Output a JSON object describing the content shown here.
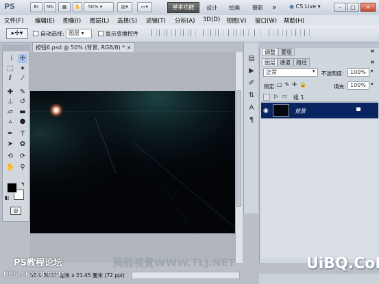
{
  "titlebar": {
    "app_logo": "PS",
    "small_btns": [
      "Br",
      "Mb"
    ],
    "zoom": "50%",
    "workspace_active": "基本功能",
    "workspaces": [
      "设计",
      "绘画",
      "摄影"
    ],
    "more": "»",
    "cslive": "CS Live",
    "window_controls": [
      "–",
      "□",
      "×"
    ]
  },
  "menu": [
    "文件(F)",
    "编辑(E)",
    "图像(I)",
    "图层(L)",
    "选择(S)",
    "滤镜(T)",
    "分析(A)",
    "3D(D)",
    "视图(V)",
    "窗口(W)",
    "帮助(H)"
  ],
  "options": {
    "auto_select": "自动选择:",
    "auto_select_value": "图层",
    "show_transform": "显示变换控件"
  },
  "document": {
    "tab_title": "按钮6.psd @ 50% (背景, RGB/8) *",
    "tab_close": "×",
    "status_zoom": "50%",
    "status_size": "30.37 厘米 x 21.45 厘米 (72 ppi)"
  },
  "panels": {
    "top_tabs": [
      "调整",
      "蒙版"
    ],
    "layer_tabs": [
      "图层",
      "通道",
      "路径"
    ],
    "blend_mode": "正常",
    "opacity_label": "不透明度:",
    "opacity_value": "100%",
    "lock_label": "锁定:",
    "fill_label": "填充:",
    "fill_value": "100%",
    "layers": [
      {
        "name": "组 1",
        "type": "group"
      },
      {
        "name": "背景",
        "type": "background",
        "selected": true
      }
    ]
  },
  "watermarks": {
    "left_title": "PS教程论坛",
    "left_bbs": "BBS.16XX8.COM",
    "middle": "腾龍視覺WWW.TLJ.NET",
    "right": "UiBQ.CoM"
  },
  "colors": {
    "selection": "#0a2461",
    "canvas": "#030509",
    "workspace_button": "#5a5a5a"
  }
}
